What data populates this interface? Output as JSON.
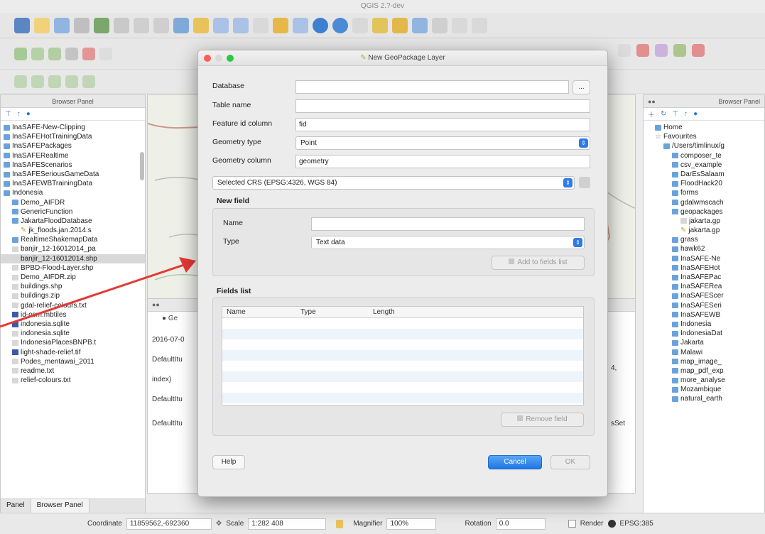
{
  "window": {
    "title": "QGIS 2.?-dev"
  },
  "dialog": {
    "title": "New GeoPackage Layer",
    "database_label": "Database",
    "database_value": "",
    "browse_label": "...",
    "table_name_label": "Table name",
    "table_name_value": "",
    "fid_label": "Feature id column",
    "fid_value": "fid",
    "geom_type_label": "Geometry type",
    "geom_type_value": "Point",
    "geom_column_label": "Geometry column",
    "geom_column_value": "geometry",
    "crs_value": "Selected CRS (EPSG:4326, WGS 84)",
    "new_field_title": "New field",
    "name_label": "Name",
    "name_value": "",
    "type_label": "Type",
    "type_value": "Text data",
    "add_to_fields_label": "Add to fields list",
    "fields_list_title": "Fields list",
    "fields_columns": [
      "Name",
      "Type",
      "Length"
    ],
    "remove_field_label": "Remove field",
    "help_label": "Help",
    "cancel_label": "Cancel",
    "ok_label": "OK"
  },
  "left_panel": {
    "title": "Browser Panel",
    "items": [
      {
        "label": "InaSAFE-New-Clipping",
        "kind": "folder",
        "indent": 0
      },
      {
        "label": "InaSAFEHotTrainingData",
        "kind": "folder",
        "indent": 0
      },
      {
        "label": "InaSAFEPackages",
        "kind": "folder",
        "indent": 0
      },
      {
        "label": "InaSAFERealtime",
        "kind": "folder",
        "indent": 0
      },
      {
        "label": "InaSAFEScenarios",
        "kind": "folder",
        "indent": 0
      },
      {
        "label": "InaSAFESeriousGameData",
        "kind": "folder",
        "indent": 0
      },
      {
        "label": "InaSAFEWBTrainingData",
        "kind": "folder",
        "indent": 0
      },
      {
        "label": "Indonesia",
        "kind": "folder",
        "indent": 0
      },
      {
        "label": "Demo_AIFDR",
        "kind": "folder",
        "indent": 1
      },
      {
        "label": "GenericFunction",
        "kind": "folder",
        "indent": 1
      },
      {
        "label": "JakartaFloodDatabase",
        "kind": "folder",
        "indent": 1
      },
      {
        "label": "jk_floods.jan.2014.s",
        "kind": "layer",
        "indent": 2
      },
      {
        "label": "RealtimeShakemapData",
        "kind": "folder",
        "indent": 1
      },
      {
        "label": "banjir_12-16012014_pa",
        "kind": "file",
        "indent": 1
      },
      {
        "label": "banjir_12-16012014.shp",
        "kind": "file",
        "indent": 1,
        "selected": true
      },
      {
        "label": "BPBD-Flood-Layer.shp",
        "kind": "file",
        "indent": 1
      },
      {
        "label": "Demo_AIFDR.zip",
        "kind": "file",
        "indent": 1
      },
      {
        "label": "buildings.shp",
        "kind": "file",
        "indent": 1
      },
      {
        "label": "buildings.zip",
        "kind": "file",
        "indent": 1
      },
      {
        "label": "gdal-relief-colours.txt",
        "kind": "file",
        "indent": 1
      },
      {
        "label": "id-osm.mbtiles",
        "kind": "raster",
        "indent": 1
      },
      {
        "label": "indonesia.sqlite",
        "kind": "raster",
        "indent": 1
      },
      {
        "label": "indonesia.sqlite",
        "kind": "file",
        "indent": 1
      },
      {
        "label": "IndonesiaPlacesBNPB.t",
        "kind": "file",
        "indent": 1
      },
      {
        "label": "light-shade-relief.tif",
        "kind": "raster",
        "indent": 1
      },
      {
        "label": "Podes_mentawai_2011",
        "kind": "file",
        "indent": 1
      },
      {
        "label": "readme.txt",
        "kind": "file",
        "indent": 1
      },
      {
        "label": "relief-colours.txt",
        "kind": "file",
        "indent": 1
      }
    ],
    "tabs": [
      "Panel",
      "Browser Panel"
    ]
  },
  "right_panel": {
    "title": "Browser Panel",
    "items": [
      {
        "label": "Home",
        "kind": "folder",
        "indent": 0
      },
      {
        "label": "Favourites",
        "kind": "star",
        "indent": 0
      },
      {
        "label": "/Users/timlinux/g",
        "kind": "folder",
        "indent": 1
      },
      {
        "label": "composer_te",
        "kind": "folder",
        "indent": 2
      },
      {
        "label": "csv_example",
        "kind": "folder",
        "indent": 2
      },
      {
        "label": "DarEsSalaam",
        "kind": "folder",
        "indent": 2
      },
      {
        "label": "FloodHack20",
        "kind": "folder",
        "indent": 2
      },
      {
        "label": "forms",
        "kind": "folder",
        "indent": 2
      },
      {
        "label": "gdalwmscach",
        "kind": "folder",
        "indent": 2
      },
      {
        "label": "geopackages",
        "kind": "folder",
        "indent": 2
      },
      {
        "label": "jakarta.gp",
        "kind": "file",
        "indent": 3
      },
      {
        "label": "jakarta.gp",
        "kind": "layer",
        "indent": 3
      },
      {
        "label": "grass",
        "kind": "folder",
        "indent": 2
      },
      {
        "label": "hawk62",
        "kind": "folder",
        "indent": 2
      },
      {
        "label": "InaSAFE-Ne",
        "kind": "folder",
        "indent": 2
      },
      {
        "label": "InaSAFEHot",
        "kind": "folder",
        "indent": 2
      },
      {
        "label": "InaSAFEPac",
        "kind": "folder",
        "indent": 2
      },
      {
        "label": "InaSAFERea",
        "kind": "folder",
        "indent": 2
      },
      {
        "label": "InaSAFEScer",
        "kind": "folder",
        "indent": 2
      },
      {
        "label": "InaSAFESeri",
        "kind": "folder",
        "indent": 2
      },
      {
        "label": "InaSAFEWB",
        "kind": "folder",
        "indent": 2
      },
      {
        "label": "Indonesia",
        "kind": "folder",
        "indent": 2
      },
      {
        "label": "IndonesiaDat",
        "kind": "folder",
        "indent": 2
      },
      {
        "label": "Jakarta",
        "kind": "folder",
        "indent": 2
      },
      {
        "label": "Malawi",
        "kind": "folder",
        "indent": 2
      },
      {
        "label": "map_image_",
        "kind": "folder",
        "indent": 2
      },
      {
        "label": "map_pdf_exp",
        "kind": "folder",
        "indent": 2
      },
      {
        "label": "more_analyse",
        "kind": "folder",
        "indent": 2
      },
      {
        "label": "Mozambique",
        "kind": "folder",
        "indent": 2
      },
      {
        "label": "natural_earth",
        "kind": "folder",
        "indent": 2
      }
    ]
  },
  "log_panel": {
    "tab_label": "Ge",
    "lines": [
      "2016-07-0",
      "DefaultItu",
      "index)",
      "DefaultItu",
      "DefaultItu"
    ],
    "right_fragments": [
      "4,",
      "sSet"
    ]
  },
  "statusbar": {
    "coordinate_label": "Coordinate",
    "coordinate_value": "11859562,-692360",
    "scale_label": "Scale",
    "scale_value": "1:282 408",
    "magnifier_label": "Magnifier",
    "magnifier_value": "100%",
    "rotation_label": "Rotation",
    "rotation_value": "0.0",
    "render_label": "Render",
    "crs_label": "EPSG:385"
  },
  "colors": {
    "accent_blue": "#2b7ce8",
    "arrow_red": "#e53935",
    "folder_blue": "#6aa3dc"
  }
}
